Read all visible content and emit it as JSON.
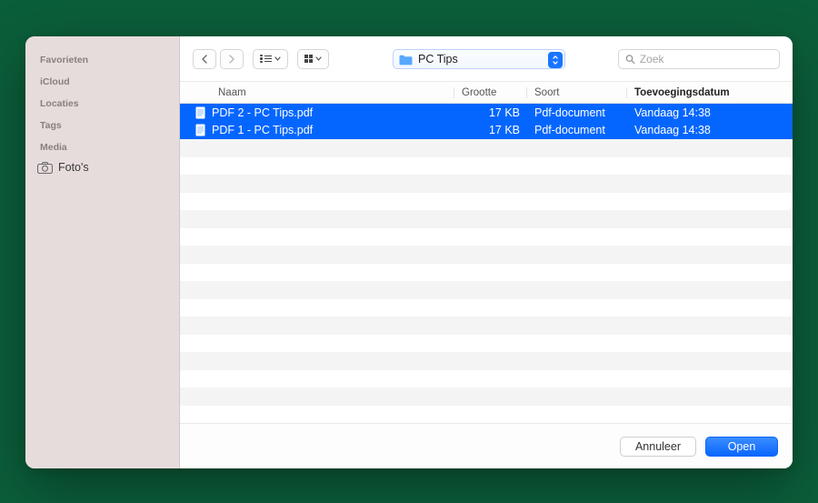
{
  "sidebar": {
    "sections": [
      {
        "heading": "Favorieten"
      },
      {
        "heading": "iCloud"
      },
      {
        "heading": "Locaties"
      },
      {
        "heading": "Tags"
      },
      {
        "heading": "Media",
        "items": [
          {
            "icon": "camera-icon",
            "label": "Foto's"
          }
        ]
      }
    ]
  },
  "toolbar": {
    "folder_label": "PC Tips",
    "search_placeholder": "Zoek"
  },
  "columns": {
    "name": "Naam",
    "size": "Grootte",
    "kind": "Soort",
    "added": "Toevoegingsdatum"
  },
  "files": [
    {
      "name": "PDF 2 - PC Tips.pdf",
      "size": "17 KB",
      "kind": "Pdf-document",
      "added": "Vandaag 14:38",
      "selected": true
    },
    {
      "name": "PDF 1 - PC Tips.pdf",
      "size": "17 KB",
      "kind": "Pdf-document",
      "added": "Vandaag 14:38",
      "selected": true
    }
  ],
  "footer": {
    "cancel_label": "Annuleer",
    "open_label": "Open"
  },
  "colors": {
    "selection": "#0566ff",
    "accent": "#1975ff"
  }
}
